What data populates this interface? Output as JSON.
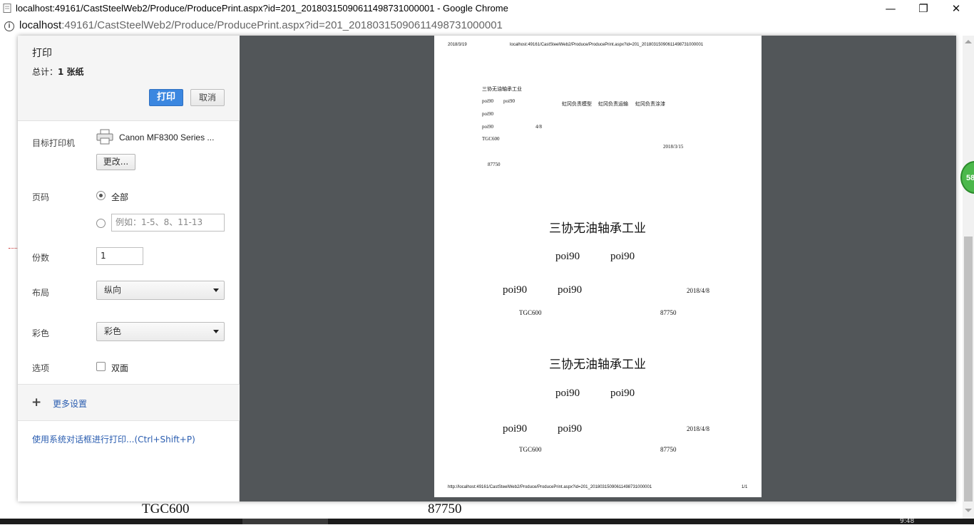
{
  "window": {
    "title": "localhost:49161/CastSteelWeb2/Produce/ProducePrint.aspx?id=201_20180315090611498731000001 - Google Chrome",
    "controls": {
      "minimize": "—",
      "restore": "❐",
      "close": "✕"
    }
  },
  "address": {
    "host": "localhost",
    "rest": ":49161/CastSteelWeb2/Produce/ProducePrint.aspx?id=201_20180315090611498731000001"
  },
  "background_page": {
    "tgc": "TGC600",
    "number": "87750",
    "badge": "58",
    "clock": "9:48"
  },
  "print_dialog": {
    "title": "打印",
    "total_prefix": "总计：",
    "total_value": "1 张纸",
    "print_button": "打印",
    "cancel_button": "取消",
    "destination_label": "目标打印机",
    "printer_name": "Canon MF8300 Series ...",
    "change_button": "更改...",
    "pages_label": "页码",
    "pages_all": "全部",
    "pages_placeholder": "例如：1-5、8、11-13",
    "copies_label": "份数",
    "copies_value": "1",
    "layout_label": "布局",
    "layout_value": "纵向",
    "color_label": "彩色",
    "color_value": "彩色",
    "options_label": "选项",
    "duplex_label": "双面",
    "more_settings": "更多设置",
    "system_dialog": "使用系统对话框进行打印...(Ctrl+Shift+P)"
  },
  "preview": {
    "header_date": "2018/3/19",
    "header_url": "localhost:49161/CastSteelWeb2/Produce/ProducePrint.aspx?id=201_20180315090611498731000001",
    "small_block": {
      "company": "三协无油轴承工业",
      "row1_a": "poi90",
      "row1_b": "poi90",
      "resp1": "虹冈负责模型",
      "resp2": "虹冈负责运输",
      "resp3": "虹冈负责涂漆",
      "row2": "poi90",
      "row3": "poi90",
      "row3_date": "4/8",
      "tgc": "TGC600",
      "date": "2018/3/15",
      "num": "87750"
    },
    "block1": {
      "company": "三协无油轴承工业",
      "a": "poi90",
      "b": "poi90",
      "c": "poi90",
      "d": "poi90",
      "date": "2018/4/8",
      "tgc": "TGC600",
      "num": "87750"
    },
    "block2": {
      "company": "三协无油轴承工业",
      "a": "poi90",
      "b": "poi90",
      "c": "poi90",
      "d": "poi90",
      "date": "2018/4/8",
      "tgc": "TGC600",
      "num": "87750"
    },
    "footer_url": "http://localhost:49161/CastSteelWeb2/Produce/ProducePrint.aspx?id=201_20180315090611498731000001",
    "footer_page": "1/1"
  }
}
